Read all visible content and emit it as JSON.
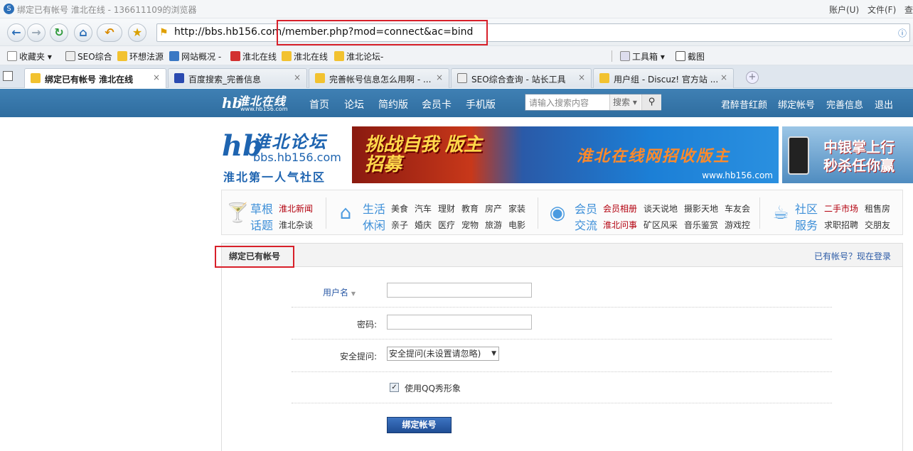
{
  "window": {
    "title": "绑定已有帐号 淮北在线 - 136611109的浏览器",
    "menu": [
      "账户(U)",
      "文件(F)",
      "查"
    ]
  },
  "address": {
    "url": "http://bbs.hb156.com/member.php?mod=connect&ac=bind"
  },
  "favorites": [
    {
      "label": "收藏夹",
      "icon": "star-icon"
    },
    {
      "label": "SEO综合",
      "icon": "page-icon"
    },
    {
      "label": "环想法源",
      "icon": "shield-icon"
    },
    {
      "label": "网站概况 -",
      "icon": "chart-icon"
    },
    {
      "label": "淮北在线",
      "icon": "bookmark-icon"
    },
    {
      "label": "淮北在线",
      "icon": "shield-icon"
    },
    {
      "label": "淮北论坛-",
      "icon": "shield-icon"
    }
  ],
  "tools": {
    "toolbox": "工具箱",
    "screenshot": "截图"
  },
  "tabs": [
    {
      "label": "绑定已有帐号 淮北在线",
      "active": true
    },
    {
      "label": "百度搜索_完善信息",
      "active": false
    },
    {
      "label": "完善帐号信息怎么用啊 - ...",
      "active": false
    },
    {
      "label": "SEO综合查询 - 站长工具",
      "active": false
    },
    {
      "label": "用户组 - Discuz! 官方站 ...",
      "active": false
    }
  ],
  "site": {
    "logo_text": "淮北在线",
    "logo_sub": "www.hb156.com",
    "nav": [
      "首页",
      "论坛",
      "简约版",
      "会员卡",
      "手机版"
    ],
    "search_placeholder": "请输入搜索内容",
    "search_select": "搜索",
    "user_links": [
      "君醉昔红颜",
      "绑定帐号",
      "完善信息",
      "退出"
    ]
  },
  "banner": {
    "logo_title": "淮北论坛",
    "logo_domain": "bbs.hb156.com",
    "logo_slogan": "淮北第一人气社区",
    "ad1_left": "挑战自我 版主招募",
    "ad1_right": "淮北在线网招收版主",
    "ad1_url": "www.hb156.com",
    "ad2": "中银掌上行 秒杀任你赢"
  },
  "categories": [
    {
      "title1": "草根",
      "title2": "话题",
      "icon": "cocktail-icon",
      "links": [
        {
          "t": "淮北新闻",
          "red": true
        },
        {
          "t": "淮北杂谈",
          "red": false
        }
      ]
    },
    {
      "title1": "生活",
      "title2": "休闲",
      "icon": "house-icon",
      "links": [
        {
          "t": "美食"
        },
        {
          "t": "汽车"
        },
        {
          "t": "理财"
        },
        {
          "t": "教育"
        },
        {
          "t": "房产"
        },
        {
          "t": "家装"
        },
        {
          "t": "亲子"
        },
        {
          "t": "婚庆"
        },
        {
          "t": "医疗"
        },
        {
          "t": "宠物"
        },
        {
          "t": "旅游"
        },
        {
          "t": "电影"
        }
      ]
    },
    {
      "title1": "会员",
      "title2": "交流",
      "icon": "chat-icon",
      "links": [
        {
          "t": "会员相册",
          "red": true
        },
        {
          "t": "谈天说地"
        },
        {
          "t": "摄影天地"
        },
        {
          "t": "车友会"
        },
        {
          "t": "淮北问事",
          "red": true
        },
        {
          "t": "矿区风采"
        },
        {
          "t": "音乐鉴赏"
        },
        {
          "t": "游戏控"
        }
      ]
    },
    {
      "title1": "社区",
      "title2": "服务",
      "icon": "coffee-icon",
      "links": [
        {
          "t": "二手市场",
          "red": true
        },
        {
          "t": "租售房"
        },
        {
          "t": "求职招聘"
        },
        {
          "t": "交朋友"
        }
      ]
    }
  ],
  "form": {
    "heading": "绑定已有帐号",
    "login_link": "已有帐号？现在登录",
    "username_label": "用户名",
    "password_label": "密码:",
    "question_label": "安全提问:",
    "question_value": "安全提问(未设置请忽略)",
    "qq_label": "使用QQ秀形象",
    "submit": "绑定帐号"
  }
}
